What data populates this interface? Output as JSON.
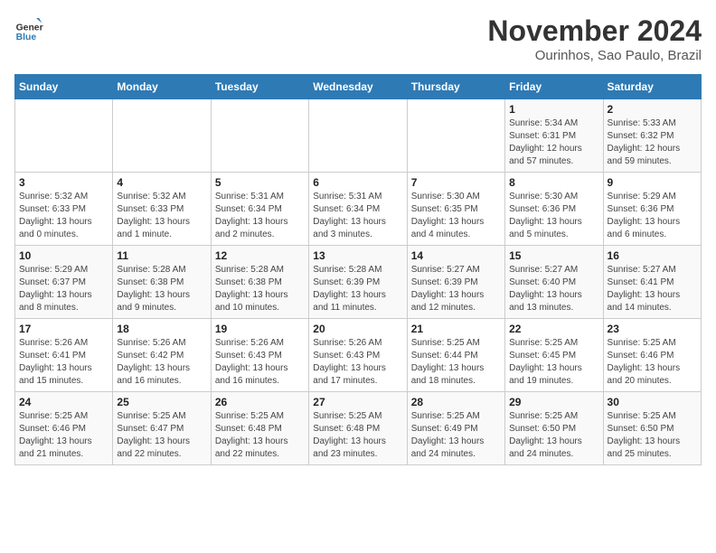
{
  "header": {
    "logo_general": "General",
    "logo_blue": "Blue",
    "month_title": "November 2024",
    "location": "Ourinhos, Sao Paulo, Brazil"
  },
  "calendar": {
    "days_of_week": [
      "Sunday",
      "Monday",
      "Tuesday",
      "Wednesday",
      "Thursday",
      "Friday",
      "Saturday"
    ],
    "weeks": [
      [
        {
          "day": "",
          "info": ""
        },
        {
          "day": "",
          "info": ""
        },
        {
          "day": "",
          "info": ""
        },
        {
          "day": "",
          "info": ""
        },
        {
          "day": "",
          "info": ""
        },
        {
          "day": "1",
          "info": "Sunrise: 5:34 AM\nSunset: 6:31 PM\nDaylight: 12 hours and 57 minutes."
        },
        {
          "day": "2",
          "info": "Sunrise: 5:33 AM\nSunset: 6:32 PM\nDaylight: 12 hours and 59 minutes."
        }
      ],
      [
        {
          "day": "3",
          "info": "Sunrise: 5:32 AM\nSunset: 6:33 PM\nDaylight: 13 hours and 0 minutes."
        },
        {
          "day": "4",
          "info": "Sunrise: 5:32 AM\nSunset: 6:33 PM\nDaylight: 13 hours and 1 minute."
        },
        {
          "day": "5",
          "info": "Sunrise: 5:31 AM\nSunset: 6:34 PM\nDaylight: 13 hours and 2 minutes."
        },
        {
          "day": "6",
          "info": "Sunrise: 5:31 AM\nSunset: 6:34 PM\nDaylight: 13 hours and 3 minutes."
        },
        {
          "day": "7",
          "info": "Sunrise: 5:30 AM\nSunset: 6:35 PM\nDaylight: 13 hours and 4 minutes."
        },
        {
          "day": "8",
          "info": "Sunrise: 5:30 AM\nSunset: 6:36 PM\nDaylight: 13 hours and 5 minutes."
        },
        {
          "day": "9",
          "info": "Sunrise: 5:29 AM\nSunset: 6:36 PM\nDaylight: 13 hours and 6 minutes."
        }
      ],
      [
        {
          "day": "10",
          "info": "Sunrise: 5:29 AM\nSunset: 6:37 PM\nDaylight: 13 hours and 8 minutes."
        },
        {
          "day": "11",
          "info": "Sunrise: 5:28 AM\nSunset: 6:38 PM\nDaylight: 13 hours and 9 minutes."
        },
        {
          "day": "12",
          "info": "Sunrise: 5:28 AM\nSunset: 6:38 PM\nDaylight: 13 hours and 10 minutes."
        },
        {
          "day": "13",
          "info": "Sunrise: 5:28 AM\nSunset: 6:39 PM\nDaylight: 13 hours and 11 minutes."
        },
        {
          "day": "14",
          "info": "Sunrise: 5:27 AM\nSunset: 6:39 PM\nDaylight: 13 hours and 12 minutes."
        },
        {
          "day": "15",
          "info": "Sunrise: 5:27 AM\nSunset: 6:40 PM\nDaylight: 13 hours and 13 minutes."
        },
        {
          "day": "16",
          "info": "Sunrise: 5:27 AM\nSunset: 6:41 PM\nDaylight: 13 hours and 14 minutes."
        }
      ],
      [
        {
          "day": "17",
          "info": "Sunrise: 5:26 AM\nSunset: 6:41 PM\nDaylight: 13 hours and 15 minutes."
        },
        {
          "day": "18",
          "info": "Sunrise: 5:26 AM\nSunset: 6:42 PM\nDaylight: 13 hours and 16 minutes."
        },
        {
          "day": "19",
          "info": "Sunrise: 5:26 AM\nSunset: 6:43 PM\nDaylight: 13 hours and 16 minutes."
        },
        {
          "day": "20",
          "info": "Sunrise: 5:26 AM\nSunset: 6:43 PM\nDaylight: 13 hours and 17 minutes."
        },
        {
          "day": "21",
          "info": "Sunrise: 5:25 AM\nSunset: 6:44 PM\nDaylight: 13 hours and 18 minutes."
        },
        {
          "day": "22",
          "info": "Sunrise: 5:25 AM\nSunset: 6:45 PM\nDaylight: 13 hours and 19 minutes."
        },
        {
          "day": "23",
          "info": "Sunrise: 5:25 AM\nSunset: 6:46 PM\nDaylight: 13 hours and 20 minutes."
        }
      ],
      [
        {
          "day": "24",
          "info": "Sunrise: 5:25 AM\nSunset: 6:46 PM\nDaylight: 13 hours and 21 minutes."
        },
        {
          "day": "25",
          "info": "Sunrise: 5:25 AM\nSunset: 6:47 PM\nDaylight: 13 hours and 22 minutes."
        },
        {
          "day": "26",
          "info": "Sunrise: 5:25 AM\nSunset: 6:48 PM\nDaylight: 13 hours and 22 minutes."
        },
        {
          "day": "27",
          "info": "Sunrise: 5:25 AM\nSunset: 6:48 PM\nDaylight: 13 hours and 23 minutes."
        },
        {
          "day": "28",
          "info": "Sunrise: 5:25 AM\nSunset: 6:49 PM\nDaylight: 13 hours and 24 minutes."
        },
        {
          "day": "29",
          "info": "Sunrise: 5:25 AM\nSunset: 6:50 PM\nDaylight: 13 hours and 24 minutes."
        },
        {
          "day": "30",
          "info": "Sunrise: 5:25 AM\nSunset: 6:50 PM\nDaylight: 13 hours and 25 minutes."
        }
      ]
    ]
  }
}
